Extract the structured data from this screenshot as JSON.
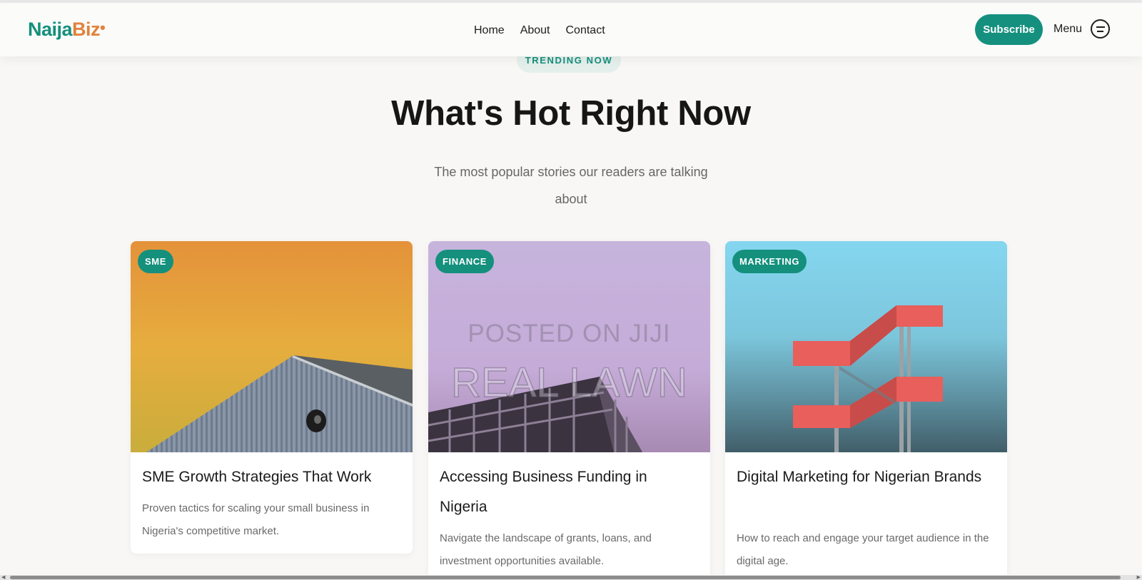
{
  "brand": {
    "part1": "Naija",
    "part2": "Biz",
    "dot": "•"
  },
  "nav": {
    "items": [
      "Home",
      "About",
      "Contact"
    ]
  },
  "header": {
    "subscribe_label": "Subscribe",
    "menu_label": "Menu"
  },
  "hero": {
    "eyebrow": "TRENDING NOW",
    "title": "What's Hot Right Now",
    "subtitle": "The most popular stories our readers are talking about"
  },
  "cards": [
    {
      "badge": "SME",
      "title": "SME Growth Strategies That Work",
      "excerpt": "Proven tactics for scaling your small business in Nigeria's competitive market."
    },
    {
      "badge": "FINANCE",
      "title": "Accessing Business Funding in Nigeria",
      "excerpt": "Navigate the landscape of grants, loans, and investment opportunities available.",
      "watermark_line1": "POSTED ON JIJI",
      "watermark_line2": "REAL LAWN"
    },
    {
      "badge": "MARKETING",
      "title": "Digital Marketing for Nigerian Brands",
      "excerpt": "How to reach and engage your target audience in the digital age."
    }
  ],
  "colors": {
    "accent": "#15907e",
    "brand_orange": "#e2823c",
    "background": "#f8f7f5"
  }
}
